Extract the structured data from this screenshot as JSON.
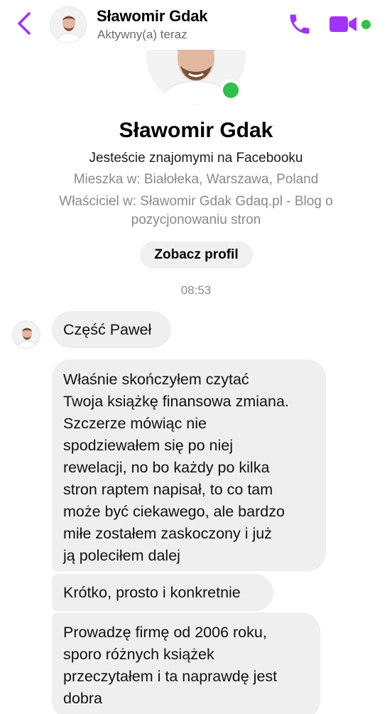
{
  "header": {
    "name": "Sławomir Gdak",
    "status": "Aktywny(a) teraz",
    "icons": {
      "back": "chevron-left-icon",
      "call": "phone-icon",
      "video": "video-camera-icon"
    }
  },
  "profile": {
    "name": "Sławomir Gdak",
    "friends_text": "Jesteście znajomymi na Facebooku",
    "lives_text": "Mieszka w: Białołeka, Warszawa, Poland",
    "owner_text": "Właściciel w: Sławomir Gdak Gdaq.pl - Blog o pozycjonowaniu stron",
    "view_profile_label": "Zobacz profil"
  },
  "chat": {
    "timestamp": "08:53",
    "messages": [
      {
        "text": "Część Paweł"
      },
      {
        "text": "Właśnie skończyłem czytać\nTwoja książkę finansowa zmiana.\nSzczerze mówiąc nie\nspodziewałem się po niej\nrewelacji, no bo każdy po kilka\nstron raptem napisał, to co tam\nmoże być ciekawego, ale bardzo\nmiłe zostałem zaskoczony i już\nją poleciłem dalej"
      },
      {
        "text": "Krótko, prosto i konkretnie"
      },
      {
        "text": "Prowadzę firmę od 2006 roku,\nsporo różnych książek\nprzeczytałem i ta naprawdę jest\ndobra"
      }
    ]
  },
  "colors": {
    "accent": "#a033ff",
    "online": "#31c048",
    "bubble": "#efefef",
    "secondary_text": "#8a8a8a"
  }
}
